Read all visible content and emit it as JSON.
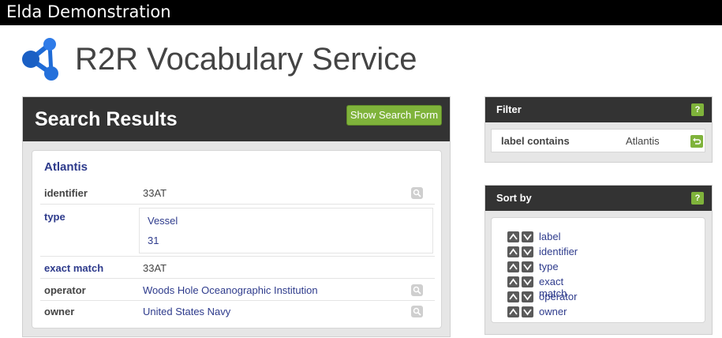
{
  "window": {
    "title": "Elda Demonstration"
  },
  "app": {
    "title": "R2R Vocabulary Service"
  },
  "results": {
    "title": "Search Results",
    "show_search_form": "Show Search Form",
    "item": {
      "label": "Atlantis",
      "properties": {
        "identifier": {
          "name": "identifier",
          "value": "33AT"
        },
        "type": {
          "name": "type",
          "values": [
            "Vessel",
            "31"
          ]
        },
        "exact_match": {
          "name": "exact match",
          "value": "33AT"
        },
        "operator": {
          "name": "operator",
          "value": "Woods Hole Oceanographic Institution"
        },
        "owner": {
          "name": "owner",
          "value": "United States Navy"
        }
      }
    }
  },
  "filter": {
    "title": "Filter",
    "help": "?",
    "key": "label contains",
    "value": "Atlantis"
  },
  "sort": {
    "title": "Sort by",
    "help": "?",
    "fields": [
      "label",
      "identifier",
      "type",
      "exact match",
      "operator",
      "owner"
    ]
  },
  "colors": {
    "header": "#333333",
    "accent_green": "#7fb33b",
    "link": "#2e3b8c",
    "logo_blue": "#1f6bd6"
  }
}
